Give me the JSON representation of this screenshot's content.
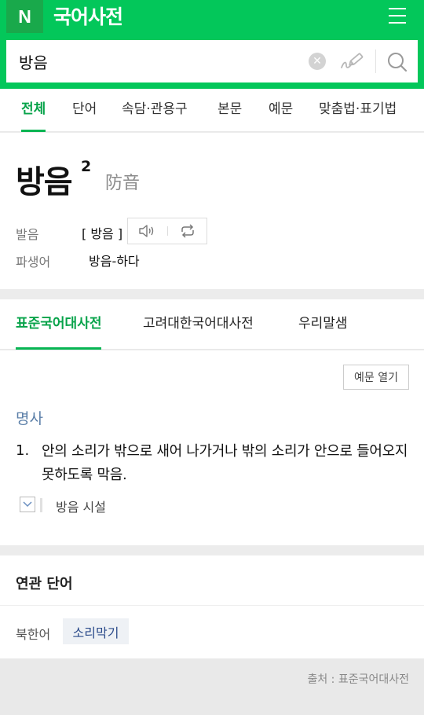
{
  "header": {
    "logo": "N",
    "title": "국어사전",
    "accent_color": "#03c75a",
    "menu_icon": "hamburger-icon"
  },
  "search": {
    "value": "방음",
    "clear_icon": "clear-icon",
    "handwrite_icon": "handwriting-pen-icon",
    "search_icon": "search-icon"
  },
  "tabs": [
    {
      "label": "전체",
      "active": true
    },
    {
      "label": "단어",
      "active": false
    },
    {
      "label": "속담·관용구",
      "active": false
    },
    {
      "label": "본문",
      "active": false
    },
    {
      "label": "예문",
      "active": false
    },
    {
      "label": "맞춤법·표기법",
      "active": false
    }
  ],
  "entry": {
    "word": "방음",
    "homonym_number": "2",
    "hanja": "防音",
    "pronunciation_label": "발음",
    "pronunciation": "[ 방음 ]",
    "derivative_label": "파생어",
    "derivative": "방음-하다"
  },
  "dict_tabs": [
    {
      "label": "표준국어대사전",
      "active": true
    },
    {
      "label": "고려대한국어대사전",
      "active": false
    },
    {
      "label": "우리말샘",
      "active": false
    }
  ],
  "meaning": {
    "example_toggle_label": "예문 열기",
    "part_of_speech": "명사",
    "definitions": [
      {
        "number": "1.",
        "text": "안의 소리가 밖으로 새어 나가거나 밖의 소리가 안으로 들어오지 못하도록 막음."
      }
    ],
    "sub_example": "방음 시설"
  },
  "related": {
    "title": "연관 단어",
    "label": "북한어",
    "word": "소리막기"
  },
  "footer": {
    "source": "출처 : 표준국어대사전"
  }
}
